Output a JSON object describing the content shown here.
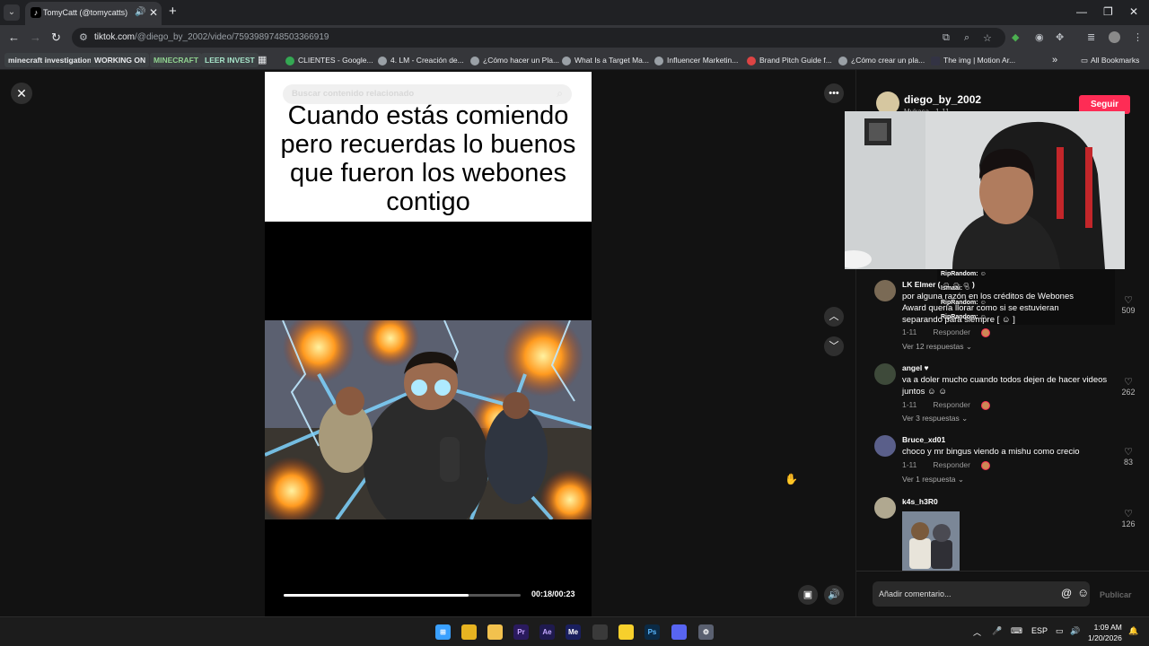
{
  "browser": {
    "tab_title": "TomyCatt (@tomycatts) | Ti",
    "url_host": "tiktok.com",
    "url_path": "/@diego_by_2002/video/7593989748503366919",
    "bookmarks": [
      {
        "label": "minecraft investigation",
        "style": "pill"
      },
      {
        "label": "WORKING ON",
        "style": "pill"
      },
      {
        "label": "MINECRAFT",
        "style": "pill",
        "color": "#8fd18f"
      },
      {
        "label": "LEER INVEST",
        "style": "pill",
        "color": "#a6e3c8"
      },
      {
        "label": "CLIENTES - Google...",
        "style": "link"
      },
      {
        "label": "4. LM - Creación de...",
        "style": "link"
      },
      {
        "label": "¿Cómo hacer un Pla...",
        "style": "link"
      },
      {
        "label": "What Is a Target Ma...",
        "style": "link"
      },
      {
        "label": "Influencer Marketin...",
        "style": "link"
      },
      {
        "label": "Brand Pitch Guide f...",
        "style": "link"
      },
      {
        "label": "¿Cómo crear un pla...",
        "style": "link"
      },
      {
        "label": "The img | Motion Ar...",
        "style": "link"
      }
    ],
    "all_bookmarks": "All Bookmarks"
  },
  "video": {
    "search_placeholder": "Buscar contenido relacionado",
    "caption": "Cuando estás comiendo pero recuerdas lo buenos que fueron los webones contigo",
    "time": "00:18/00:23",
    "progress": 0.78
  },
  "author": {
    "name": "diego_by_2002",
    "sub": "Mukasa · 1-11",
    "follow_label": "Seguir"
  },
  "stream_chat": [
    {
      "user": "RipRandom:",
      "text": "☺"
    },
    {
      "user": "Ismaai:",
      "text": "☺"
    },
    {
      "user": "RipRandom:",
      "text": "☺"
    },
    {
      "user": "RipRandom:",
      "text": "☺"
    }
  ],
  "comments": [
    {
      "user": "LK Elmer ( ☺ ☺ ☺ )",
      "text": "por alguna razón en los créditos de Webones Award quería llorar como si se estuvieran separando para siempre [ ☺ ]",
      "date": "1-11",
      "reply_label": "Responder",
      "replies": "Ver 12 respuestas ⌄",
      "likes": "509",
      "avatar_color": "#7a6a55"
    },
    {
      "user": "angel ♥",
      "text": "va a doler mucho cuando todos dejen de hacer videos juntos ☺ ☺",
      "date": "1-11",
      "reply_label": "Responder",
      "replies": "Ver 3 respuestas ⌄",
      "likes": "262",
      "avatar_color": "#3e4a3a"
    },
    {
      "user": "Bruce_xd01",
      "text": "choco y mr bingus viendo a mishu como crecio",
      "date": "1-11",
      "reply_label": "Responder",
      "replies": "Ver 1 respuesta ⌄",
      "likes": "83",
      "avatar_color": "#5a5f8a"
    },
    {
      "user": "k4s_h3R0",
      "text": "",
      "date": "",
      "reply_label": "",
      "replies": "",
      "likes": "126",
      "avatar_color": "#b0a890"
    }
  ],
  "comment_input": {
    "placeholder": "Añadir comentario...",
    "publish_label": "Publicar"
  },
  "taskbar": {
    "apps": [
      {
        "label": "",
        "name": "windows-start-icon",
        "color": "#3aa0ff"
      },
      {
        "label": "",
        "name": "chrome-icon",
        "color": "#e7b321"
      },
      {
        "label": "",
        "name": "file-explorer-icon",
        "color": "#f2c14e"
      },
      {
        "label": "Pr",
        "name": "premiere-icon",
        "color": "#2a1a5e"
      },
      {
        "label": "Ae",
        "name": "after-effects-icon",
        "color": "#1f1a4f"
      },
      {
        "label": "Me",
        "name": "media-encoder-icon",
        "color": "#1a1f5e"
      },
      {
        "label": "",
        "name": "obs-icon",
        "color": "#3a3a3a"
      },
      {
        "label": "",
        "name": "sticky-notes-icon",
        "color": "#f7d02c"
      },
      {
        "label": "Ps",
        "name": "photoshop-icon",
        "color": "#0b2a45"
      },
      {
        "label": "",
        "name": "discord-icon",
        "color": "#5865f2"
      },
      {
        "label": "",
        "name": "settings-icon",
        "color": "#5a6070"
      }
    ],
    "language": "ESP",
    "time": "1:09 AM",
    "date": "1/20/2026"
  }
}
